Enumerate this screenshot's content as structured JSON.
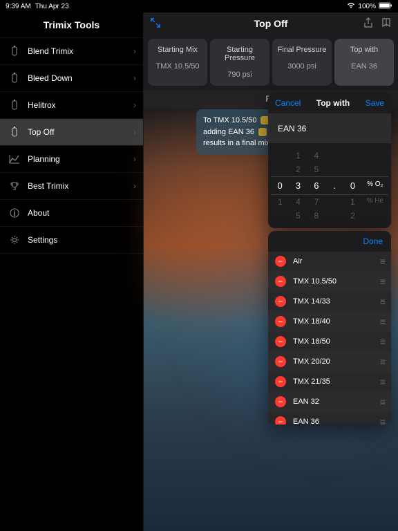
{
  "status": {
    "time": "9:39 AM",
    "date": "Thu Apr 23",
    "battery": "100%"
  },
  "sidebar": {
    "title": "Trimix Tools",
    "items": [
      {
        "label": "Blend Trimix"
      },
      {
        "label": "Bleed Down"
      },
      {
        "label": "Helitrox"
      },
      {
        "label": "Top Off"
      },
      {
        "label": "Planning"
      },
      {
        "label": "Best Trimix"
      },
      {
        "label": "About"
      },
      {
        "label": "Settings"
      }
    ]
  },
  "main": {
    "title": "Top Off",
    "cards": [
      {
        "title": "Starting Mix",
        "value": "TMX 10.5/50"
      },
      {
        "title": "Starting Pressure",
        "value": "790 psi"
      },
      {
        "title": "Final Pressure",
        "value": "3000 psi"
      },
      {
        "title": "Top with",
        "value": "EAN 36"
      }
    ],
    "banner": "Re",
    "bubble": {
      "line1": "To TMX 10.5/50",
      "line2": "adding EAN 36",
      "line3": "results in a final mix of:"
    }
  },
  "popover": {
    "cancel": "Cancel",
    "title": "Top with",
    "save": "Save",
    "field": "EAN 36",
    "picker_rows": [
      [
        "",
        "1",
        "4",
        "",
        ""
      ],
      [
        "",
        "2",
        "5",
        "",
        ""
      ],
      [
        "0",
        "3",
        "6",
        ".",
        "0"
      ],
      [
        "1",
        "4",
        "7",
        "",
        "1"
      ],
      [
        "",
        "5",
        "8",
        "",
        "2"
      ]
    ],
    "unit_o2": "% O₂",
    "unit_he": "% He"
  },
  "list": {
    "done": "Done",
    "rows": [
      "Air",
      "TMX 10.5/50",
      "TMX 14/33",
      "TMX 18/40",
      "TMX 18/50",
      "TMX 20/20",
      "TMX 21/35",
      "EAN 32",
      "EAN 36"
    ]
  }
}
